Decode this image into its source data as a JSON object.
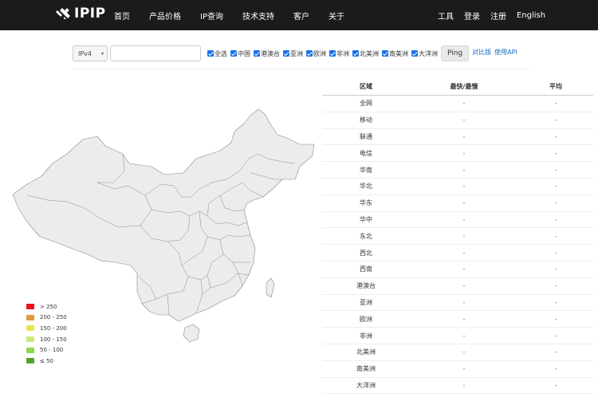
{
  "logo": {
    "text": "IPIP"
  },
  "nav": {
    "left": [
      "首页",
      "产品价格",
      "IP查询",
      "技术支持",
      "客户",
      "关于"
    ],
    "right": [
      "工具",
      "登录",
      "注册",
      "English"
    ]
  },
  "toolbar": {
    "ip_version": "IPv4",
    "input_value": "",
    "checkboxes": [
      "全选",
      "中国",
      "港澳台",
      "亚洲",
      "欧洲",
      "非洲",
      "北美洲",
      "南美洲",
      "大洋洲"
    ],
    "ping_label": "Ping",
    "link_compare": "对比版",
    "link_api": "使用API"
  },
  "legend": [
    {
      "label": "> 250",
      "color": "#e8141b"
    },
    {
      "label": "200 - 250",
      "color": "#e09a3a"
    },
    {
      "label": "150 - 200",
      "color": "#ece34f"
    },
    {
      "label": "100 - 150",
      "color": "#cbe87a"
    },
    {
      "label": "50 - 100",
      "color": "#8dd64a"
    },
    {
      "label": "≤ 50",
      "color": "#5aa02c"
    }
  ],
  "table": {
    "headers": [
      "区域",
      "最快/最慢",
      "平均"
    ],
    "rows": [
      [
        "全网",
        "-",
        "-"
      ],
      [
        "移动",
        "-",
        "-"
      ],
      [
        "联通",
        "-",
        "-"
      ],
      [
        "电信",
        "-",
        "-"
      ],
      [
        "华南",
        "-",
        "-"
      ],
      [
        "华北",
        "-",
        "-"
      ],
      [
        "华东",
        "-",
        "-"
      ],
      [
        "华中",
        "-",
        "-"
      ],
      [
        "东北",
        "-",
        "-"
      ],
      [
        "西北",
        "-",
        "-"
      ],
      [
        "西南",
        "-",
        "-"
      ],
      [
        "港澳台",
        "-",
        "-"
      ],
      [
        "亚洲",
        "-",
        "-"
      ],
      [
        "欧洲",
        "-",
        "-"
      ],
      [
        "非洲",
        "-",
        "-"
      ],
      [
        "北美洲",
        "-",
        "-"
      ],
      [
        "南美洲",
        "-",
        "-"
      ],
      [
        "大洋洲",
        "-",
        "-"
      ]
    ]
  },
  "colors": {
    "topbar": "#1b1b1b",
    "checkbox": "#1a73e8",
    "link": "#1a6fbf",
    "map_fill": "#ececec",
    "map_border": "#8a8a8a"
  }
}
